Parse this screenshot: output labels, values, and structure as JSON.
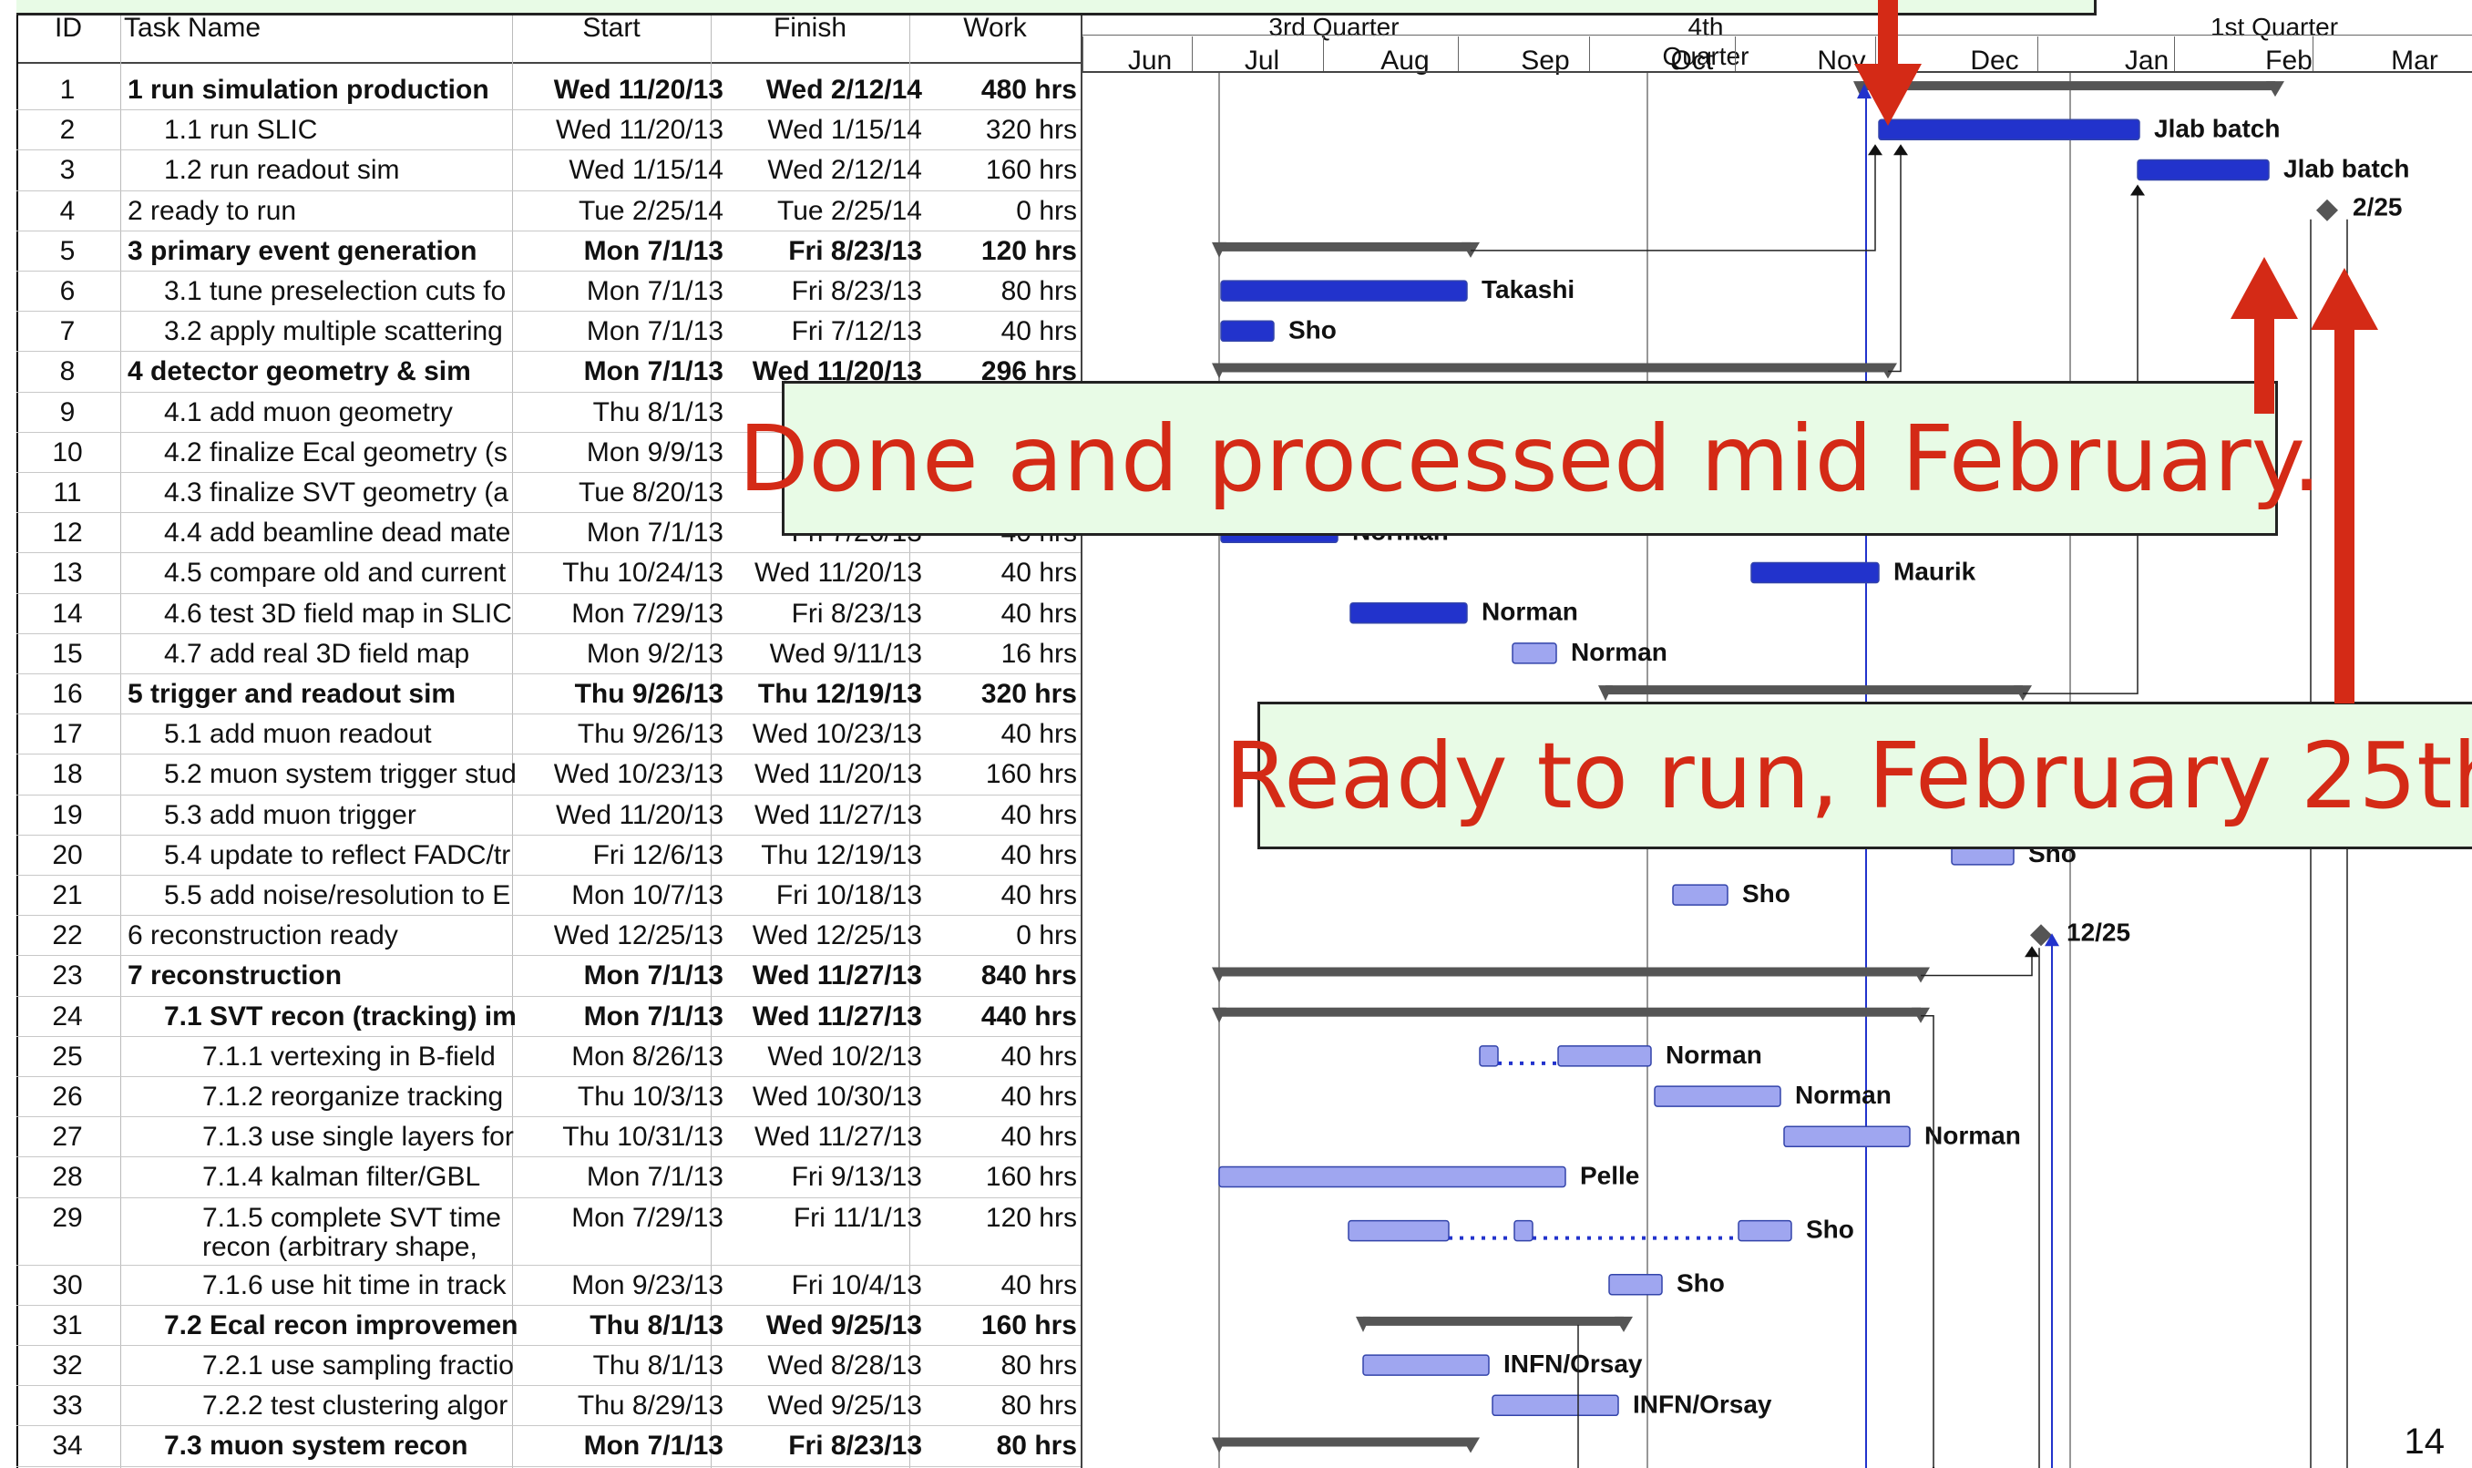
{
  "columns": {
    "id": "ID",
    "name": "Task Name",
    "start": "Start",
    "finish": "Finish",
    "work": "Work"
  },
  "quarters": [
    "3rd Quarter",
    "4th Quarter",
    "1st Quarter"
  ],
  "months": [
    "Jun",
    "Jul",
    "Aug",
    "Sep",
    "Oct",
    "Nov",
    "Dec",
    "Jan",
    "Feb",
    "Mar"
  ],
  "rows": [
    {
      "id": "1",
      "name": "1 run simulation production",
      "start": "Wed 11/20/13",
      "finish": "Wed 2/12/14",
      "work": "480 hrs",
      "indent": 0,
      "bold": true
    },
    {
      "id": "2",
      "name": "1.1 run SLIC",
      "start": "Wed 11/20/13",
      "finish": "Wed 1/15/14",
      "work": "320 hrs",
      "indent": 1,
      "bold": false
    },
    {
      "id": "3",
      "name": "1.2 run readout sim",
      "start": "Wed 1/15/14",
      "finish": "Wed 2/12/14",
      "work": "160 hrs",
      "indent": 1,
      "bold": false
    },
    {
      "id": "4",
      "name": "2 ready to run",
      "start": "Tue 2/25/14",
      "finish": "Tue 2/25/14",
      "work": "0 hrs",
      "indent": 0,
      "bold": false
    },
    {
      "id": "5",
      "name": "3 primary event generation",
      "start": "Mon 7/1/13",
      "finish": "Fri 8/23/13",
      "work": "120 hrs",
      "indent": 0,
      "bold": true
    },
    {
      "id": "6",
      "name": "3.1 tune preselection cuts fo",
      "start": "Mon 7/1/13",
      "finish": "Fri 8/23/13",
      "work": "80 hrs",
      "indent": 1,
      "bold": false
    },
    {
      "id": "7",
      "name": "3.2 apply multiple scattering",
      "start": "Mon 7/1/13",
      "finish": "Fri 7/12/13",
      "work": "40 hrs",
      "indent": 1,
      "bold": false
    },
    {
      "id": "8",
      "name": "4 detector geometry & sim",
      "start": "Mon 7/1/13",
      "finish": "Wed 11/20/13",
      "work": "296 hrs",
      "indent": 0,
      "bold": true
    },
    {
      "id": "9",
      "name": "4.1 add muon geometry",
      "start": "Thu 8/1/13",
      "finish": "W",
      "work": "",
      "indent": 1,
      "bold": false
    },
    {
      "id": "10",
      "name": "4.2 finalize Ecal geometry (s",
      "start": "Mon 9/9/13",
      "finish": "",
      "work": "",
      "indent": 1,
      "bold": false
    },
    {
      "id": "11",
      "name": "4.3 finalize SVT geometry (a",
      "start": "Tue 8/20/13",
      "finish": "",
      "work": "",
      "indent": 1,
      "bold": false
    },
    {
      "id": "12",
      "name": "4.4 add beamline dead mate",
      "start": "Mon 7/1/13",
      "finish": "Fri 7/26/13",
      "work": "40 hrs",
      "indent": 1,
      "bold": false
    },
    {
      "id": "13",
      "name": "4.5 compare old and current",
      "start": "Thu 10/24/13",
      "finish": "Wed 11/20/13",
      "work": "40 hrs",
      "indent": 1,
      "bold": false
    },
    {
      "id": "14",
      "name": "4.6 test 3D field map in SLIC",
      "start": "Mon 7/29/13",
      "finish": "Fri 8/23/13",
      "work": "40 hrs",
      "indent": 1,
      "bold": false
    },
    {
      "id": "15",
      "name": "4.7 add real 3D field map",
      "start": "Mon 9/2/13",
      "finish": "Wed 9/11/13",
      "work": "16 hrs",
      "indent": 1,
      "bold": false
    },
    {
      "id": "16",
      "name": "5 trigger and readout sim",
      "start": "Thu 9/26/13",
      "finish": "Thu 12/19/13",
      "work": "320 hrs",
      "indent": 0,
      "bold": true
    },
    {
      "id": "17",
      "name": "5.1 add muon readout",
      "start": "Thu 9/26/13",
      "finish": "Wed 10/23/13",
      "work": "40 hrs",
      "indent": 1,
      "bold": false
    },
    {
      "id": "18",
      "name": "5.2 muon system trigger stud",
      "start": "Wed 10/23/13",
      "finish": "Wed 11/20/13",
      "work": "160 hrs",
      "indent": 1,
      "bold": false
    },
    {
      "id": "19",
      "name": "5.3 add muon trigger",
      "start": "Wed 11/20/13",
      "finish": "Wed 11/27/13",
      "work": "40 hrs",
      "indent": 1,
      "bold": false
    },
    {
      "id": "20",
      "name": "5.4 update to reflect FADC/tr",
      "start": "Fri 12/6/13",
      "finish": "Thu 12/19/13",
      "work": "40 hrs",
      "indent": 1,
      "bold": false
    },
    {
      "id": "21",
      "name": "5.5 add noise/resolution to E",
      "start": "Mon 10/7/13",
      "finish": "Fri 10/18/13",
      "work": "40 hrs",
      "indent": 1,
      "bold": false
    },
    {
      "id": "22",
      "name": "6 reconstruction ready",
      "start": "Wed 12/25/13",
      "finish": "Wed 12/25/13",
      "work": "0 hrs",
      "indent": 0,
      "bold": false
    },
    {
      "id": "23",
      "name": "7 reconstruction",
      "start": "Mon 7/1/13",
      "finish": "Wed 11/27/13",
      "work": "840 hrs",
      "indent": 0,
      "bold": true
    },
    {
      "id": "24",
      "name": "7.1 SVT recon (tracking) im",
      "start": "Mon 7/1/13",
      "finish": "Wed 11/27/13",
      "work": "440 hrs",
      "indent": 1,
      "bold": true
    },
    {
      "id": "25",
      "name": "7.1.1 vertexing in B-field",
      "start": "Mon 8/26/13",
      "finish": "Wed 10/2/13",
      "work": "40 hrs",
      "indent": 2,
      "bold": false
    },
    {
      "id": "26",
      "name": "7.1.2 reorganize tracking",
      "start": "Thu 10/3/13",
      "finish": "Wed 10/30/13",
      "work": "40 hrs",
      "indent": 2,
      "bold": false
    },
    {
      "id": "27",
      "name": "7.1.3 use single layers for",
      "start": "Thu 10/31/13",
      "finish": "Wed 11/27/13",
      "work": "40 hrs",
      "indent": 2,
      "bold": false
    },
    {
      "id": "28",
      "name": "7.1.4 kalman filter/GBL",
      "start": "Mon 7/1/13",
      "finish": "Fri 9/13/13",
      "work": "160 hrs",
      "indent": 2,
      "bold": false
    },
    {
      "id": "29",
      "name": "7.1.5 complete SVT time",
      "name2": "recon (arbitrary shape,",
      "start": "Mon 7/29/13",
      "finish": "Fri 11/1/13",
      "work": "120 hrs",
      "indent": 2,
      "bold": false
    },
    {
      "id": "30",
      "name": "7.1.6 use hit time in track",
      "start": "Mon 9/23/13",
      "finish": "Fri 10/4/13",
      "work": "40 hrs",
      "indent": 2,
      "bold": false
    },
    {
      "id": "31",
      "name": "7.2 Ecal recon improvemen",
      "start": "Thu 8/1/13",
      "finish": "Wed 9/25/13",
      "work": "160 hrs",
      "indent": 1,
      "bold": true
    },
    {
      "id": "32",
      "name": "7.2.1 use sampling fractio",
      "start": "Thu 8/1/13",
      "finish": "Wed 8/28/13",
      "work": "80 hrs",
      "indent": 2,
      "bold": false
    },
    {
      "id": "33",
      "name": "7.2.2 test clustering algor",
      "start": "Thu 8/29/13",
      "finish": "Wed 9/25/13",
      "work": "80 hrs",
      "indent": 2,
      "bold": false
    },
    {
      "id": "34",
      "name": "7.3 muon system recon",
      "start": "Mon 7/1/13",
      "finish": "Fri 8/23/13",
      "work": "80 hrs",
      "indent": 1,
      "bold": true
    }
  ],
  "bar_labels": {
    "r2": "Jlab batch",
    "r3": "Jlab batch",
    "r4": "2/25",
    "r6": "Takashi",
    "r7": "Sho",
    "r12": "Norman",
    "r13": "Maurik",
    "r14": "Norman",
    "r15": "Norman",
    "r20": "Sho",
    "r21": "Sho",
    "r22": "12/25",
    "r25": "Norman",
    "r26": "Norman",
    "r27": "Norman",
    "r28": "Pelle",
    "r29": "Sho",
    "r30": "Sho",
    "r32": "INFN/Orsay",
    "r33": "INFN/Orsay"
  },
  "notes": {
    "processed": "Done and processed mid February.",
    "ready": "Ready to run, February 25th"
  },
  "page_number": "14",
  "colors": {
    "bar_dark": "#2233cc",
    "bar_light": "#9fa6f0",
    "summary": "#555555",
    "arrow": "#d42a16",
    "note_bg": "#e8fbe6",
    "note_text": "#d42a16",
    "today": "#2233cc"
  }
}
